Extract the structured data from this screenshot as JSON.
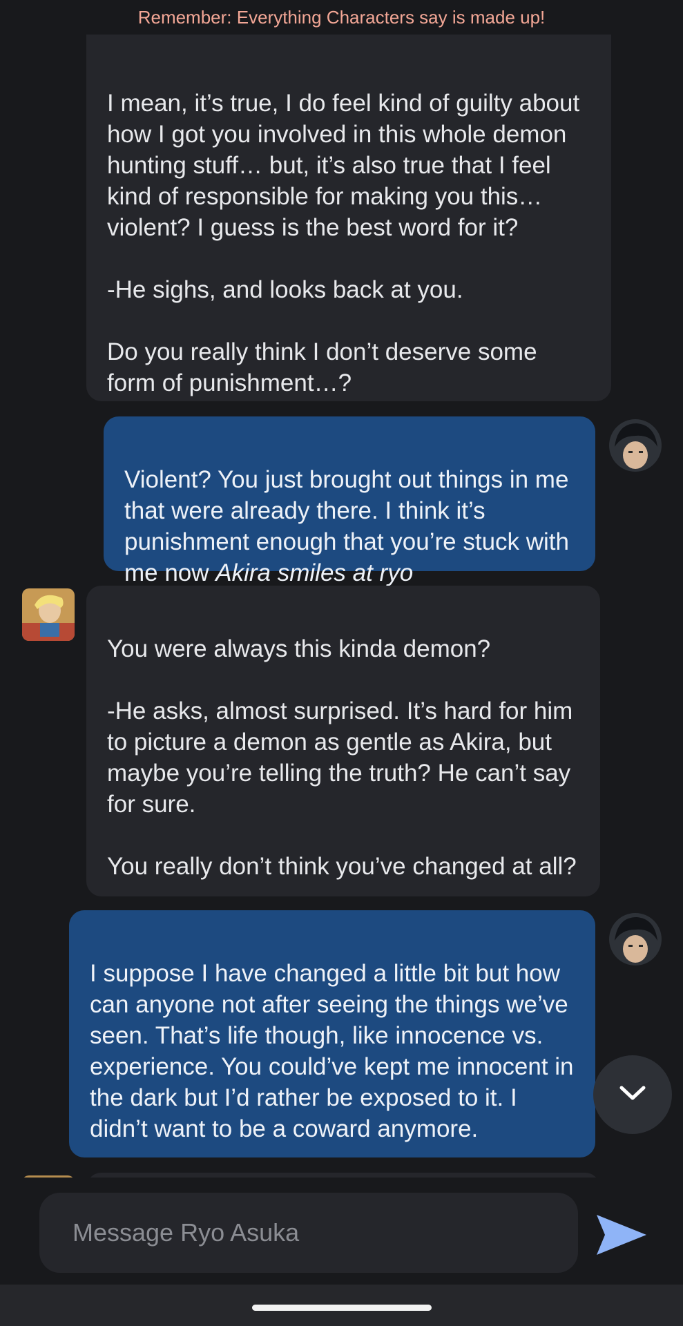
{
  "banner": {
    "text": "Remember: Everything Characters say is made up!"
  },
  "messages": [
    {
      "sender": "bot",
      "text": "I mean, it’s true, I do feel kind of guilty about how I got you involved in this whole demon hunting stuff… but, it’s also true that I feel kind of responsible for making you this… violent? I guess is the best word for it?\n\n-He sighs, and looks back at you.\n\nDo you really think I don’t deserve some form of punishment…?"
    },
    {
      "sender": "user",
      "text": "Violent? You just brought out things in me that were already there. I think it’s punishment enough that you’re stuck with me now ",
      "italic": "Akira smiles at ryo"
    },
    {
      "sender": "bot",
      "text": "You were always this kinda demon?\n\n-He asks, almost surprised. It’s hard for him to picture a demon as gentle as Akira, but maybe you’re telling the truth? He can’t say for sure.\n\nYou really don’t think you’ve changed at all?"
    },
    {
      "sender": "user",
      "text": "I suppose I have changed a little bit but how can anyone not after seeing the things we’ve seen. That’s life though, like innocence vs. experience. You could’ve kept me innocent in the dark but I’d rather be exposed to it. I didn’t want to be a coward anymore."
    }
  ],
  "composer": {
    "placeholder": "Message Ryo Asuka"
  },
  "icons": {
    "scroll": "chevron-down-icon",
    "send": "send-icon",
    "user_avatar": "akira-avatar",
    "bot_avatar": "ryo-avatar"
  },
  "colors": {
    "background": "#18191c",
    "bot_bubble": "#25262b",
    "user_bubble": "#1d4a80",
    "banner_text": "#f3a796",
    "send_icon": "#8fb4f7"
  }
}
